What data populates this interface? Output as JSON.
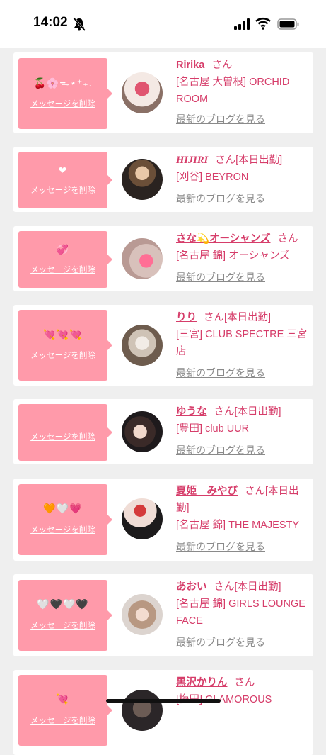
{
  "status": {
    "time": "14:02"
  },
  "delete_label": "メッセージを削除",
  "san_label": "さん",
  "blog_label": "最新のブログを見る",
  "colors": {
    "pink": "#ff9aaa",
    "name": "#d63d6a",
    "link_gray": "#8a8a8a"
  },
  "cards": [
    {
      "message": "🍒🌸ᯓ⋆⁺₊.",
      "name": "Ririka",
      "status": "",
      "shop": "[名古屋 大曽根] ORCHID ROOM"
    },
    {
      "message": "❤︎",
      "name": "HIJIRI",
      "status": "[本日出勤]",
      "shop": "[刈谷] BEYRON"
    },
    {
      "message": "💞",
      "name": "さな💫オーシャンズ",
      "status": "",
      "shop": "[名古屋 錦] オーシャンズ"
    },
    {
      "message": "💘💘💘",
      "name": "りり",
      "status": "[本日出勤]",
      "shop": "[三宮] CLUB SPECTRE 三宮店"
    },
    {
      "message": "",
      "name": "ゆうな",
      "status": "[本日出勤]",
      "shop": "[豊田] club UUR"
    },
    {
      "message": "🧡🤍💗",
      "name": "夏姫　みやび",
      "status": "[本日出勤]",
      "shop": "[名古屋 錦] THE MAJESTY"
    },
    {
      "message": "🤍🖤🤍🖤",
      "name": "あおい",
      "status": "[本日出勤]",
      "shop": "[名古屋 錦] GIRLS LOUNGE FACE"
    },
    {
      "message": "💘",
      "name": "黒沢かりん",
      "status": "",
      "shop": "[梅田] GLAMOROUS"
    }
  ]
}
